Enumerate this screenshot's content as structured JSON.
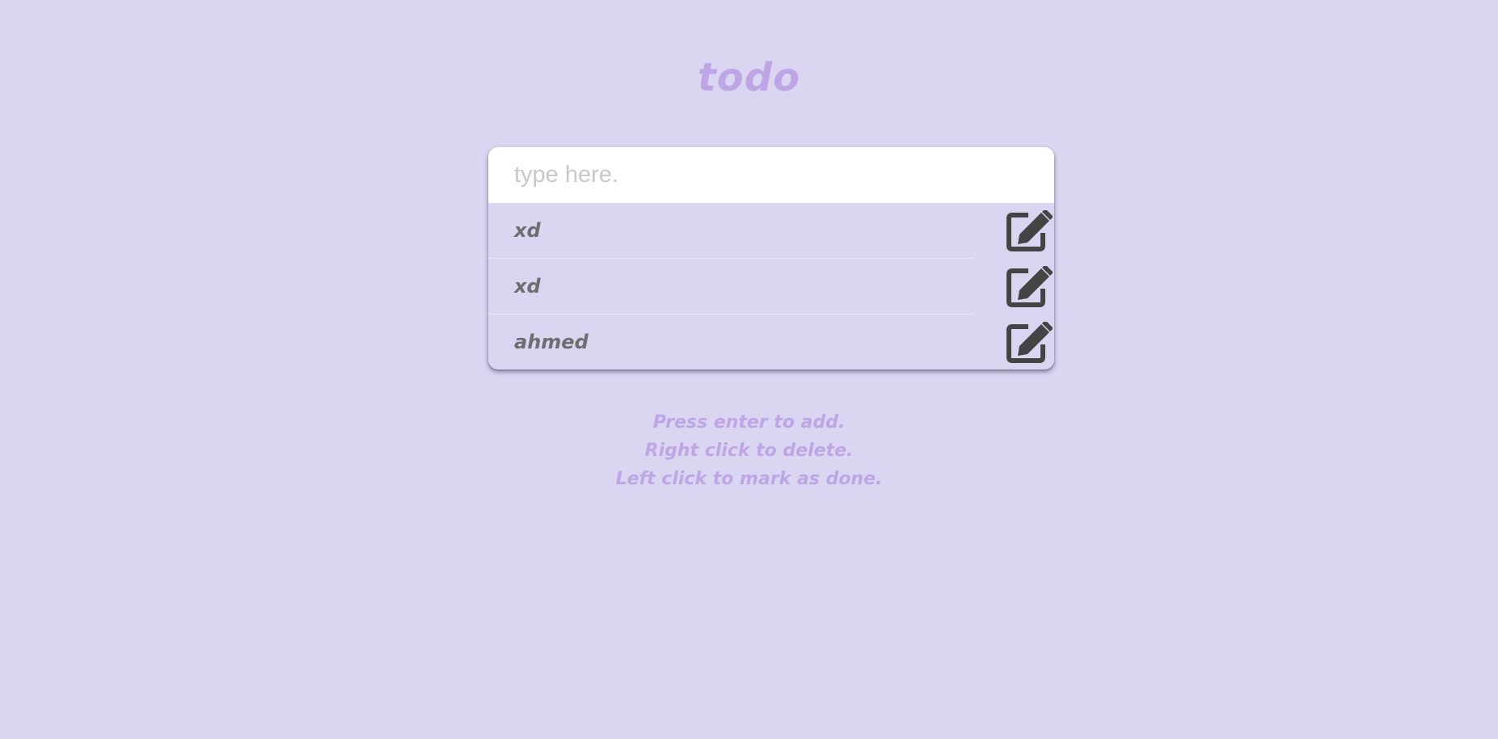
{
  "app": {
    "title": "todo",
    "accent_color": "#bea6e6",
    "background_color": "#dad6f2"
  },
  "input": {
    "placeholder": "type here.",
    "value": ""
  },
  "todos": [
    {
      "text": "xd",
      "icon": "edit-icon"
    },
    {
      "text": "xd",
      "icon": "edit-icon"
    },
    {
      "text": "ahmed",
      "icon": "edit-icon"
    }
  ],
  "hints": [
    "Press enter to add.",
    "Right click to delete.",
    "Left click to mark as done."
  ]
}
